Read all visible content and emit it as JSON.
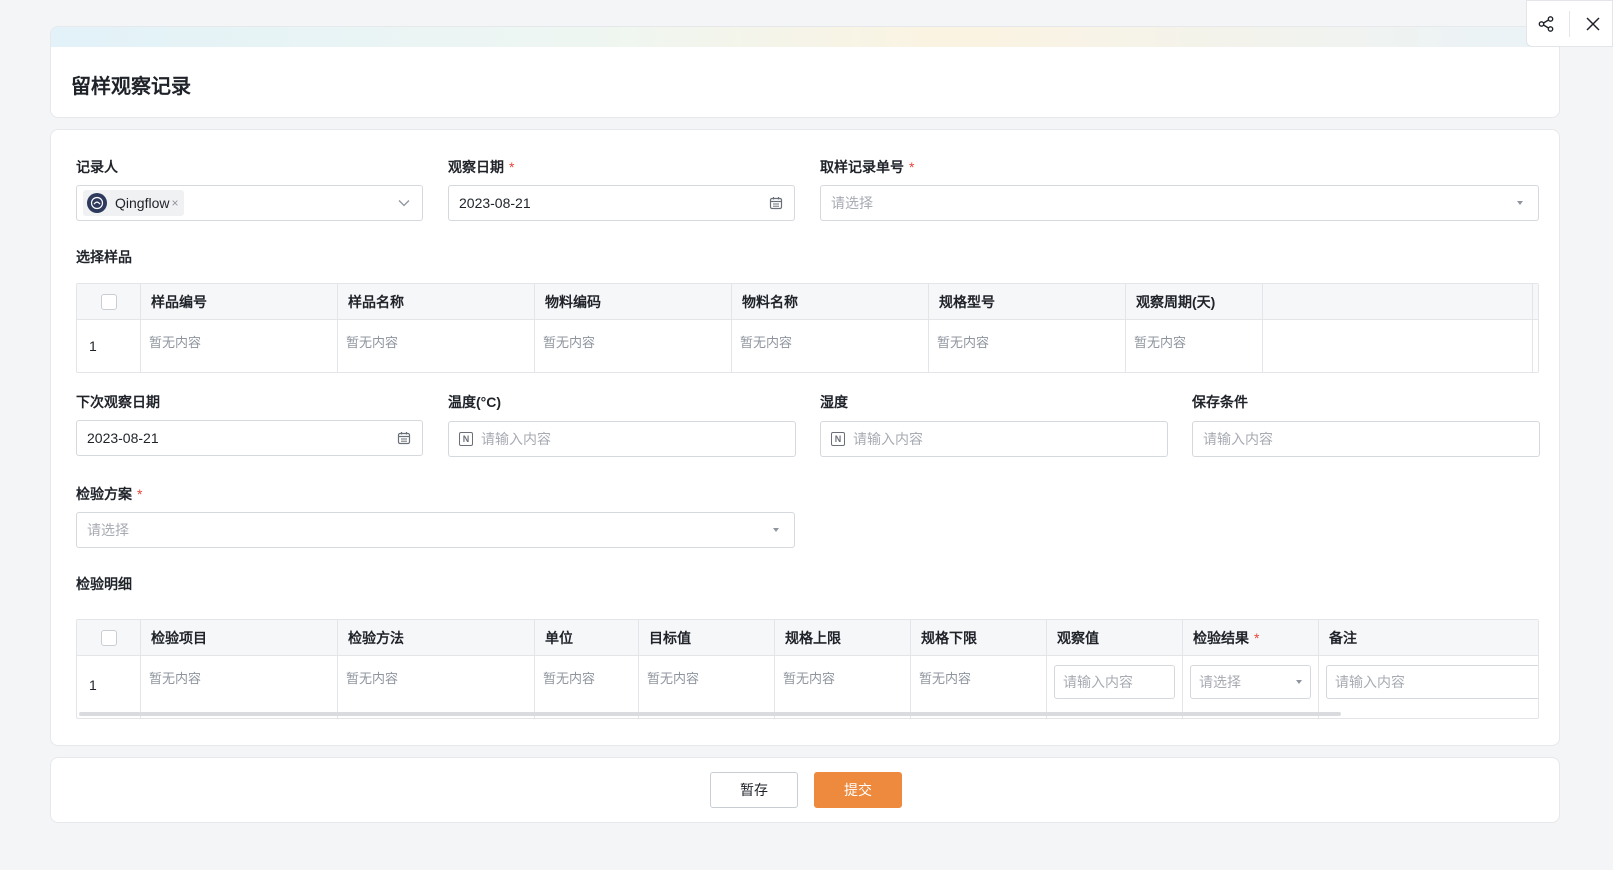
{
  "page": {
    "title": "留样观察记录"
  },
  "fields": {
    "recorder": {
      "label": "记录人",
      "tag": "Qingflow",
      "tag_close": "×"
    },
    "observe_date": {
      "label": "观察日期",
      "required_mark": "*",
      "value": "2023-08-21"
    },
    "sampling_no": {
      "label": "取样记录单号",
      "required_mark": "*",
      "placeholder": "请选择"
    },
    "select_sample": {
      "label": "选择样品"
    },
    "next_date": {
      "label": "下次观察日期",
      "value": "2023-08-21"
    },
    "temperature": {
      "label": "温度(°C)",
      "placeholder": "请输入内容",
      "num_icon": "N"
    },
    "humidity": {
      "label": "湿度",
      "placeholder": "请输入内容",
      "num_icon": "N"
    },
    "storage": {
      "label": "保存条件",
      "placeholder": "请输入内容"
    },
    "plan": {
      "label": "检验方案",
      "required_mark": "*",
      "placeholder": "请选择"
    },
    "detail": {
      "label": "检验明细"
    }
  },
  "sample_table": {
    "columns": [
      "样品编号",
      "样品名称",
      "物料编码",
      "物料名称",
      "规格型号",
      "观察周期(天)"
    ],
    "rows": [
      {
        "index": "1",
        "cells": [
          "暂无内容",
          "暂无内容",
          "暂无内容",
          "暂无内容",
          "暂无内容",
          "暂无内容"
        ]
      }
    ]
  },
  "detail_table": {
    "columns": [
      "检验项目",
      "检验方法",
      "单位",
      "目标值",
      "规格上限",
      "规格下限",
      "观察值",
      "检验结果",
      "备注"
    ],
    "required_mark": "*",
    "rows": [
      {
        "index": "1",
        "cells": [
          "暂无内容",
          "暂无内容",
          "暂无内容",
          "暂无内容",
          "暂无内容",
          "暂无内容"
        ],
        "observe_placeholder": "请输入内容",
        "result_placeholder": "请选择",
        "remark_placeholder": "请输入内容"
      }
    ]
  },
  "buttons": {
    "save": "暂存",
    "submit": "提交"
  },
  "icons": {
    "share": "share-icon",
    "close": "close-icon",
    "calendar": "calendar-icon"
  },
  "colors": {
    "accent": "#ee8a3e",
    "required": "#e8453c"
  }
}
